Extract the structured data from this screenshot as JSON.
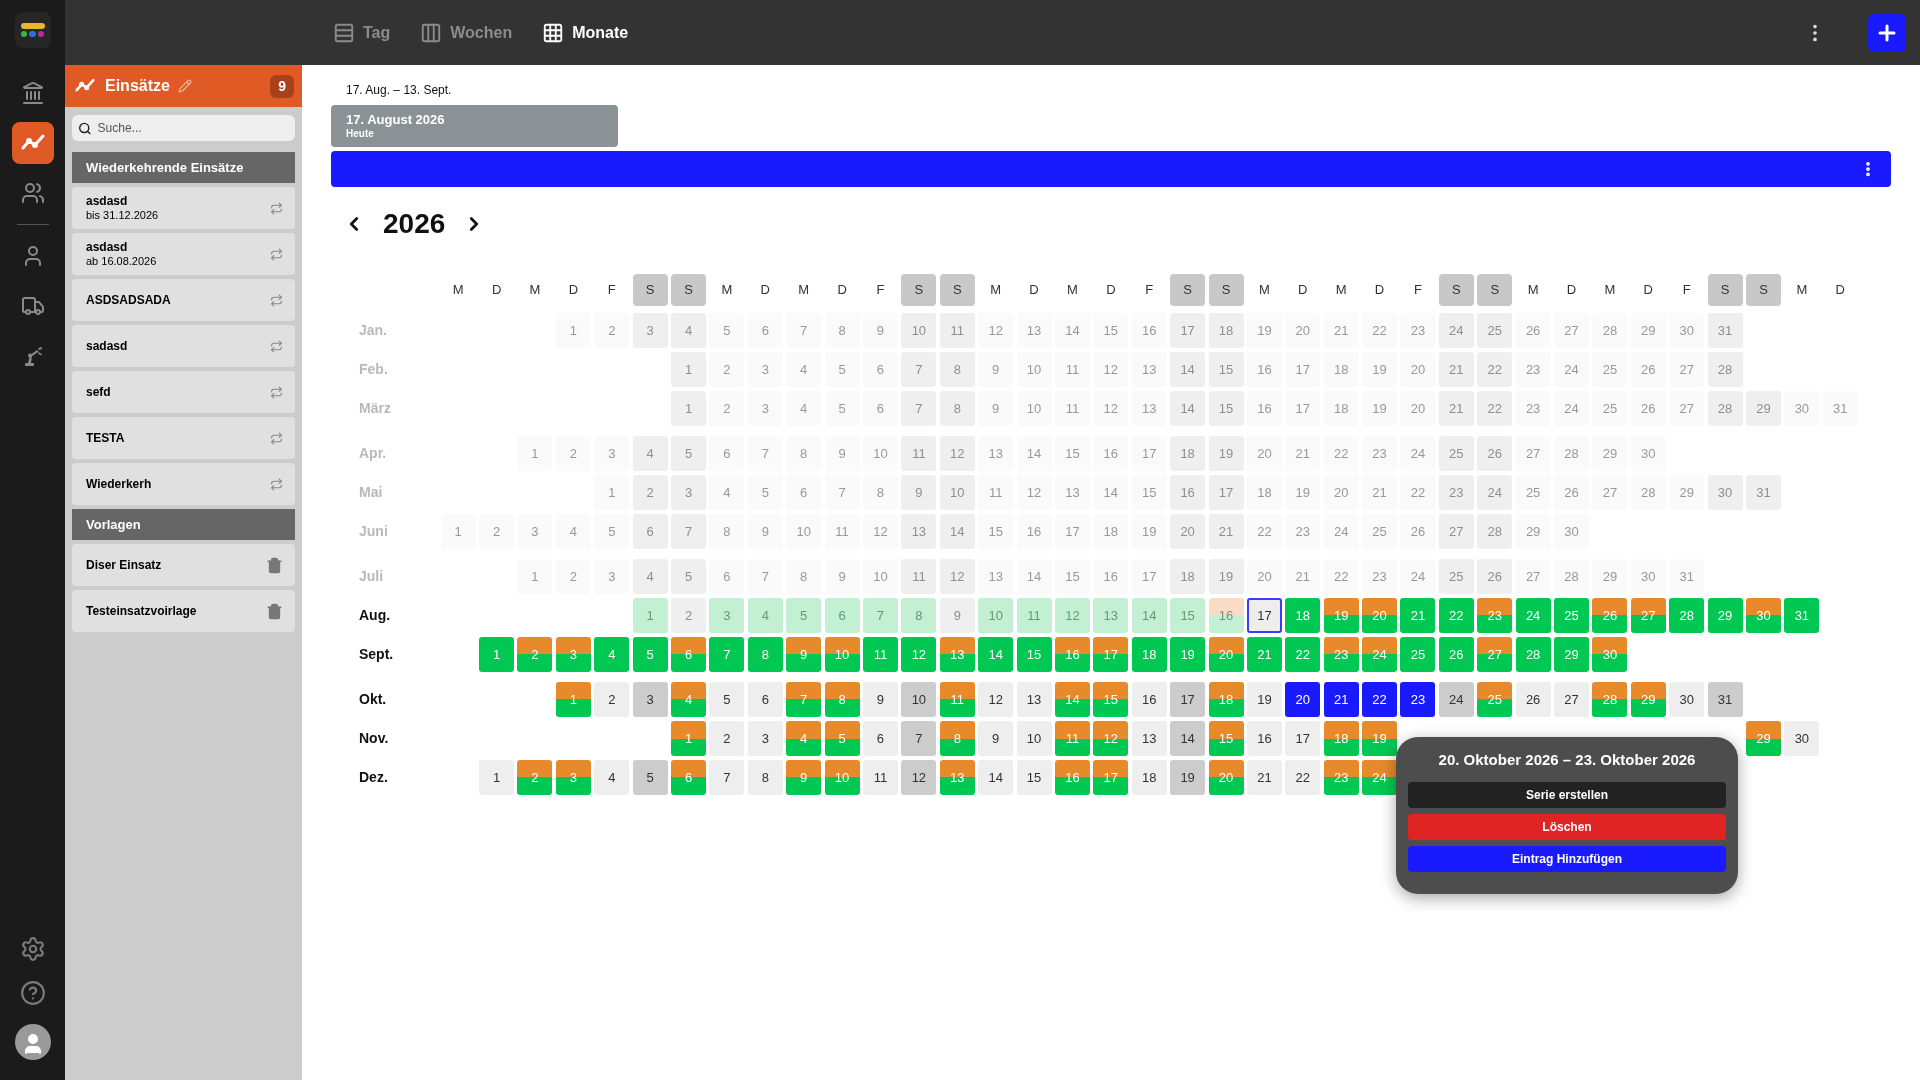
{
  "topbar": {
    "tabs": [
      {
        "label": "Tag",
        "kind": "day",
        "selected": false
      },
      {
        "label": "Wochen",
        "kind": "week",
        "selected": false
      },
      {
        "label": "Monate",
        "kind": "month",
        "selected": true
      }
    ]
  },
  "rail": {
    "groups": [
      [
        {
          "kind": "building",
          "selected": false
        },
        {
          "kind": "trend",
          "selected": true
        },
        {
          "kind": "team",
          "selected": false
        }
      ],
      [
        {
          "kind": "person",
          "selected": false
        },
        {
          "kind": "truck",
          "selected": false
        },
        {
          "kind": "robot",
          "selected": false
        }
      ]
    ]
  },
  "panel": {
    "title": "Einsätze",
    "count": "9",
    "search": {
      "placeholder": "Suche..."
    },
    "sections": [
      {
        "title": "Wiederkehrende Einsätze",
        "kind": "recurring",
        "items": [
          {
            "title": "asdasd",
            "subtitle": "bis 31.12.2026"
          },
          {
            "title": "asdasd",
            "subtitle": "ab 16.08.2026"
          },
          {
            "title": "ASDSADSADA"
          },
          {
            "title": "sadasd"
          },
          {
            "title": "sefd"
          },
          {
            "title": "TESTA"
          },
          {
            "title": "Wiederkerh"
          }
        ]
      },
      {
        "title": "Vorlagen",
        "kind": "template",
        "items": [
          {
            "title": "Diser Einsatz"
          },
          {
            "title": "Testeinsatzvoirlage"
          }
        ]
      }
    ]
  },
  "main": {
    "range": "17. Aug. – 13. Sept.",
    "today_card": {
      "title": "17. August 2026",
      "subtitle": "Heute"
    },
    "calendar": {
      "year": "2026",
      "weekdays": [
        "M",
        "D",
        "M",
        "D",
        "F",
        "S",
        "S",
        "M",
        "D",
        "M",
        "D",
        "F",
        "S",
        "S",
        "M",
        "D",
        "M",
        "D",
        "F",
        "S",
        "S",
        "M",
        "D",
        "M",
        "D",
        "F",
        "S",
        "S",
        "M",
        "D",
        "M",
        "D",
        "F",
        "S",
        "S",
        "M",
        "D"
      ],
      "months": [
        {
          "label": "Jan.",
          "past": true,
          "days": [
            {
              "label": "1",
              "kind": "past"
            },
            {
              "label": "2",
              "kind": "past"
            },
            {
              "label": "3",
              "kind": "past"
            },
            {
              "label": "4",
              "kind": "past"
            },
            {
              "label": "5",
              "kind": "past"
            },
            {
              "label": "6",
              "kind": "past"
            },
            {
              "label": "7",
              "kind": "past"
            },
            {
              "label": "8",
              "kind": "past"
            },
            {
              "label": "9",
              "kind": "past"
            },
            {
              "label": "10",
              "kind": "past"
            },
            {
              "label": "11",
              "kind": "past"
            },
            {
              "label": "12",
              "kind": "past"
            },
            {
              "label": "13",
              "kind": "past"
            },
            {
              "label": "14",
              "kind": "past"
            },
            {
              "label": "15",
              "kind": "past"
            },
            {
              "label": "16",
              "kind": "past"
            },
            {
              "label": "17",
              "kind": "past"
            },
            {
              "label": "18",
              "kind": "past"
            },
            {
              "label": "19",
              "kind": "past"
            },
            {
              "label": "20",
              "kind": "past"
            },
            {
              "label": "21",
              "kind": "past"
            },
            {
              "label": "22",
              "kind": "past"
            },
            {
              "label": "23",
              "kind": "past"
            },
            {
              "label": "24",
              "kind": "past"
            },
            {
              "label": "25",
              "kind": "past"
            },
            {
              "label": "26",
              "kind": "past"
            },
            {
              "label": "27",
              "kind": "past"
            },
            {
              "label": "28",
              "kind": "past"
            },
            {
              "label": "29",
              "kind": "past"
            },
            {
              "label": "30",
              "kind": "past"
            },
            {
              "label": "31",
              "kind": "past"
            }
          ]
        },
        {
          "label": "Feb.",
          "past": true,
          "days": [
            {
              "label": "1",
              "kind": "past"
            },
            {
              "label": "2",
              "kind": "past"
            },
            {
              "label": "3",
              "kind": "past"
            },
            {
              "label": "4",
              "kind": "past"
            },
            {
              "label": "5",
              "kind": "past"
            },
            {
              "label": "6",
              "kind": "past"
            },
            {
              "label": "7",
              "kind": "past"
            },
            {
              "label": "8",
              "kind": "past"
            },
            {
              "label": "9",
              "kind": "past"
            },
            {
              "label": "10",
              "kind": "past"
            },
            {
              "label": "11",
              "kind": "past"
            },
            {
              "label": "12",
              "kind": "past"
            },
            {
              "label": "13",
              "kind": "past"
            },
            {
              "label": "14",
              "kind": "past"
            },
            {
              "label": "15",
              "kind": "past"
            },
            {
              "label": "16",
              "kind": "past"
            },
            {
              "label": "17",
              "kind": "past"
            },
            {
              "label": "18",
              "kind": "past"
            },
            {
              "label": "19",
              "kind": "past"
            },
            {
              "label": "20",
              "kind": "past"
            },
            {
              "label": "21",
              "kind": "past"
            },
            {
              "label": "22",
              "kind": "past"
            },
            {
              "label": "23",
              "kind": "past"
            },
            {
              "label": "24",
              "kind": "past"
            },
            {
              "label": "25",
              "kind": "past"
            },
            {
              "label": "26",
              "kind": "past"
            },
            {
              "label": "27",
              "kind": "past"
            },
            {
              "label": "28",
              "kind": "past"
            }
          ]
        },
        {
          "label": "März",
          "past": true,
          "days": [
            {
              "label": "1",
              "kind": "past"
            },
            {
              "label": "2",
              "kind": "past"
            },
            {
              "label": "3",
              "kind": "past"
            },
            {
              "label": "4",
              "kind": "past"
            },
            {
              "label": "5",
              "kind": "past"
            },
            {
              "label": "6",
              "kind": "past"
            },
            {
              "label": "7",
              "kind": "past"
            },
            {
              "label": "8",
              "kind": "past"
            },
            {
              "label": "9",
              "kind": "past"
            },
            {
              "label": "10",
              "kind": "past"
            },
            {
              "label": "11",
              "kind": "past"
            },
            {
              "label": "12",
              "kind": "past"
            },
            {
              "label": "13",
              "kind": "past"
            },
            {
              "label": "14",
              "kind": "past"
            },
            {
              "label": "15",
              "kind": "past"
            },
            {
              "label": "16",
              "kind": "past"
            },
            {
              "label": "17",
              "kind": "past"
            },
            {
              "label": "18",
              "kind": "past"
            },
            {
              "label": "19",
              "kind": "past"
            },
            {
              "label": "20",
              "kind": "past"
            },
            {
              "label": "21",
              "kind": "past"
            },
            {
              "label": "22",
              "kind": "past"
            },
            {
              "label": "23",
              "kind": "past"
            },
            {
              "label": "24",
              "kind": "past"
            },
            {
              "label": "25",
              "kind": "past"
            },
            {
              "label": "26",
              "kind": "past"
            },
            {
              "label": "27",
              "kind": "past"
            },
            {
              "label": "28",
              "kind": "past"
            },
            {
              "label": "29",
              "kind": "past"
            },
            {
              "label": "30",
              "kind": "past"
            },
            {
              "label": "31",
              "kind": "past"
            }
          ]
        },
        {
          "label": "Apr.",
          "past": true,
          "days": [
            {
              "label": "1",
              "kind": "past"
            },
            {
              "label": "2",
              "kind": "past"
            },
            {
              "label": "3",
              "kind": "past"
            },
            {
              "label": "4",
              "kind": "past"
            },
            {
              "label": "5",
              "kind": "past"
            },
            {
              "label": "6",
              "kind": "past"
            },
            {
              "label": "7",
              "kind": "past"
            },
            {
              "label": "8",
              "kind": "past"
            },
            {
              "label": "9",
              "kind": "past"
            },
            {
              "label": "10",
              "kind": "past"
            },
            {
              "label": "11",
              "kind": "past"
            },
            {
              "label": "12",
              "kind": "past"
            },
            {
              "label": "13",
              "kind": "past"
            },
            {
              "label": "14",
              "kind": "past"
            },
            {
              "label": "15",
              "kind": "past"
            },
            {
              "label": "16",
              "kind": "past"
            },
            {
              "label": "17",
              "kind": "past"
            },
            {
              "label": "18",
              "kind": "past"
            },
            {
              "label": "19",
              "kind": "past"
            },
            {
              "label": "20",
              "kind": "past"
            },
            {
              "label": "21",
              "kind": "past"
            },
            {
              "label": "22",
              "kind": "past"
            },
            {
              "label": "23",
              "kind": "past"
            },
            {
              "label": "24",
              "kind": "past"
            },
            {
              "label": "25",
              "kind": "past"
            },
            {
              "label": "26",
              "kind": "past"
            },
            {
              "label": "27",
              "kind": "past"
            },
            {
              "label": "28",
              "kind": "past"
            },
            {
              "label": "29",
              "kind": "past"
            },
            {
              "label": "30",
              "kind": "past"
            }
          ]
        },
        {
          "label": "Mai",
          "past": true,
          "days": [
            {
              "label": "1",
              "kind": "past"
            },
            {
              "label": "2",
              "kind": "past"
            },
            {
              "label": "3",
              "kind": "past"
            },
            {
              "label": "4",
              "kind": "past"
            },
            {
              "label": "5",
              "kind": "past"
            },
            {
              "label": "6",
              "kind": "past"
            },
            {
              "label": "7",
              "kind": "past"
            },
            {
              "label": "8",
              "kind": "past"
            },
            {
              "label": "9",
              "kind": "past"
            },
            {
              "label": "10",
              "kind": "past"
            },
            {
              "label": "11",
              "kind": "past"
            },
            {
              "label": "12",
              "kind": "past"
            },
            {
              "label": "13",
              "kind": "past"
            },
            {
              "label": "14",
              "kind": "past"
            },
            {
              "label": "15",
              "kind": "past"
            },
            {
              "label": "16",
              "kind": "past"
            },
            {
              "label": "17",
              "kind": "past"
            },
            {
              "label": "18",
              "kind": "past"
            },
            {
              "label": "19",
              "kind": "past"
            },
            {
              "label": "20",
              "kind": "past"
            },
            {
              "label": "21",
              "kind": "past"
            },
            {
              "label": "22",
              "kind": "past"
            },
            {
              "label": "23",
              "kind": "past"
            },
            {
              "label": "24",
              "kind": "past"
            },
            {
              "label": "25",
              "kind": "past"
            },
            {
              "label": "26",
              "kind": "past"
            },
            {
              "label": "27",
              "kind": "past"
            },
            {
              "label": "28",
              "kind": "past"
            },
            {
              "label": "29",
              "kind": "past"
            },
            {
              "label": "30",
              "kind": "past"
            },
            {
              "label": "31",
              "kind": "past"
            }
          ]
        },
        {
          "label": "Juni",
          "past": true,
          "days": [
            {
              "label": "1",
              "kind": "past"
            },
            {
              "label": "2",
              "kind": "past"
            },
            {
              "label": "3",
              "kind": "past"
            },
            {
              "label": "4",
              "kind": "past"
            },
            {
              "label": "5",
              "kind": "past"
            },
            {
              "label": "6",
              "kind": "past"
            },
            {
              "label": "7",
              "kind": "past"
            },
            {
              "label": "8",
              "kind": "past"
            },
            {
              "label": "9",
              "kind": "past"
            },
            {
              "label": "10",
              "kind": "past"
            },
            {
              "label": "11",
              "kind": "past"
            },
            {
              "label": "12",
              "kind": "past"
            },
            {
              "label": "13",
              "kind": "past"
            },
            {
              "label": "14",
              "kind": "past"
            },
            {
              "label": "15",
              "kind": "past"
            },
            {
              "label": "16",
              "kind": "past"
            },
            {
              "label": "17",
              "kind": "past"
            },
            {
              "label": "18",
              "kind": "past"
            },
            {
              "label": "19",
              "kind": "past"
            },
            {
              "label": "20",
              "kind": "past"
            },
            {
              "label": "21",
              "kind": "past"
            },
            {
              "label": "22",
              "kind": "past"
            },
            {
              "label": "23",
              "kind": "past"
            },
            {
              "label": "24",
              "kind": "past"
            },
            {
              "label": "25",
              "kind": "past"
            },
            {
              "label": "26",
              "kind": "past"
            },
            {
              "label": "27",
              "kind": "past"
            },
            {
              "label": "28",
              "kind": "past"
            },
            {
              "label": "29",
              "kind": "past"
            },
            {
              "label": "30",
              "kind": "past"
            }
          ]
        },
        {
          "label": "Juli",
          "past": true,
          "days": [
            {
              "label": "1",
              "kind": "past"
            },
            {
              "label": "2",
              "kind": "past"
            },
            {
              "label": "3",
              "kind": "past"
            },
            {
              "label": "4",
              "kind": "past"
            },
            {
              "label": "5",
              "kind": "past"
            },
            {
              "label": "6",
              "kind": "past"
            },
            {
              "label": "7",
              "kind": "past"
            },
            {
              "label": "8",
              "kind": "past"
            },
            {
              "label": "9",
              "kind": "past"
            },
            {
              "label": "10",
              "kind": "past"
            },
            {
              "label": "11",
              "kind": "past"
            },
            {
              "label": "12",
              "kind": "past"
            },
            {
              "label": "13",
              "kind": "past"
            },
            {
              "label": "14",
              "kind": "past"
            },
            {
              "label": "15",
              "kind": "past"
            },
            {
              "label": "16",
              "kind": "past"
            },
            {
              "label": "17",
              "kind": "past"
            },
            {
              "label": "18",
              "kind": "past"
            },
            {
              "label": "19",
              "kind": "past"
            },
            {
              "label": "20",
              "kind": "past"
            },
            {
              "label": "21",
              "kind": "past"
            },
            {
              "label": "22",
              "kind": "past"
            },
            {
              "label": "23",
              "kind": "past"
            },
            {
              "label": "24",
              "kind": "past"
            },
            {
              "label": "25",
              "kind": "past"
            },
            {
              "label": "26",
              "kind": "past"
            },
            {
              "label": "27",
              "kind": "past"
            },
            {
              "label": "28",
              "kind": "past"
            },
            {
              "label": "29",
              "kind": "past"
            },
            {
              "label": "30",
              "kind": "past"
            },
            {
              "label": "31",
              "kind": "past"
            }
          ]
        },
        {
          "label": "Aug.",
          "past": false,
          "days": [
            {
              "label": "1",
              "kind": "past-full"
            },
            {
              "label": "2",
              "kind": "past"
            },
            {
              "label": "3",
              "kind": "past-full"
            },
            {
              "label": "4",
              "kind": "past-full"
            },
            {
              "label": "5",
              "kind": "past-full"
            },
            {
              "label": "6",
              "kind": "past-full"
            },
            {
              "label": "7",
              "kind": "past-full"
            },
            {
              "label": "8",
              "kind": "past-full"
            },
            {
              "label": "9",
              "kind": "past"
            },
            {
              "label": "10",
              "kind": "past-full"
            },
            {
              "label": "11",
              "kind": "past-full"
            },
            {
              "label": "12",
              "kind": "past-full"
            },
            {
              "label": "13",
              "kind": "past-full"
            },
            {
              "label": "14",
              "kind": "past-full"
            },
            {
              "label": "15",
              "kind": "past-full"
            },
            {
              "label": "16",
              "kind": "past-partial"
            },
            {
              "label": "17",
              "kind": "today"
            },
            {
              "label": "18",
              "kind": "full"
            },
            {
              "label": "19",
              "kind": "partial"
            },
            {
              "label": "20",
              "kind": "partial"
            },
            {
              "label": "21",
              "kind": "full"
            },
            {
              "label": "22",
              "kind": "full"
            },
            {
              "label": "23",
              "kind": "partial"
            },
            {
              "label": "24",
              "kind": "full"
            },
            {
              "label": "25",
              "kind": "full"
            },
            {
              "label": "26",
              "kind": "partial"
            },
            {
              "label": "27",
              "kind": "partial"
            },
            {
              "label": "28",
              "kind": "full"
            },
            {
              "label": "29",
              "kind": "full"
            },
            {
              "label": "30",
              "kind": "partial"
            },
            {
              "label": "31",
              "kind": "full"
            }
          ]
        },
        {
          "label": "Sept.",
          "past": false,
          "days": [
            {
              "label": "1",
              "kind": "full"
            },
            {
              "label": "2",
              "kind": "partial"
            },
            {
              "label": "3",
              "kind": "partial"
            },
            {
              "label": "4",
              "kind": "full"
            },
            {
              "label": "5",
              "kind": "full"
            },
            {
              "label": "6",
              "kind": "partial"
            },
            {
              "label": "7",
              "kind": "full"
            },
            {
              "label": "8",
              "kind": "full"
            },
            {
              "label": "9",
              "kind": "partial"
            },
            {
              "label": "10",
              "kind": "partial"
            },
            {
              "label": "11",
              "kind": "full"
            },
            {
              "label": "12",
              "kind": "full"
            },
            {
              "label": "13",
              "kind": "partial"
            },
            {
              "label": "14",
              "kind": "full"
            },
            {
              "label": "15",
              "kind": "full"
            },
            {
              "label": "16",
              "kind": "partial"
            },
            {
              "label": "17",
              "kind": "partial"
            },
            {
              "label": "18",
              "kind": "full"
            },
            {
              "label": "19",
              "kind": "full"
            },
            {
              "label": "20",
              "kind": "partial"
            },
            {
              "label": "21",
              "kind": "full"
            },
            {
              "label": "22",
              "kind": "full"
            },
            {
              "label": "23",
              "kind": "partial"
            },
            {
              "label": "24",
              "kind": "partial"
            },
            {
              "label": "25",
              "kind": "full"
            },
            {
              "label": "26",
              "kind": "full"
            },
            {
              "label": "27",
              "kind": "partial"
            },
            {
              "label": "28",
              "kind": "full"
            },
            {
              "label": "29",
              "kind": "full"
            },
            {
              "label": "30",
              "kind": "partial"
            }
          ]
        },
        {
          "label": "Okt.",
          "past": false,
          "days": [
            {
              "label": "1",
              "kind": "partial"
            },
            {
              "label": "2",
              "kind": "free"
            },
            {
              "label": "3",
              "kind": "free"
            },
            {
              "label": "4",
              "kind": "partial"
            },
            {
              "label": "5",
              "kind": "free"
            },
            {
              "label": "6",
              "kind": "free"
            },
            {
              "label": "7",
              "kind": "partial"
            },
            {
              "label": "8",
              "kind": "partial"
            },
            {
              "label": "9",
              "kind": "free"
            },
            {
              "label": "10",
              "kind": "free"
            },
            {
              "label": "11",
              "kind": "partial"
            },
            {
              "label": "12",
              "kind": "free"
            },
            {
              "label": "13",
              "kind": "free"
            },
            {
              "label": "14",
              "kind": "partial"
            },
            {
              "label": "15",
              "kind": "partial"
            },
            {
              "label": "16",
              "kind": "free"
            },
            {
              "label": "17",
              "kind": "free"
            },
            {
              "label": "18",
              "kind": "partial"
            },
            {
              "label": "19",
              "kind": "free"
            },
            {
              "label": "20",
              "kind": "selected"
            },
            {
              "label": "21",
              "kind": "selected"
            },
            {
              "label": "22",
              "kind": "selected"
            },
            {
              "label": "23",
              "kind": "selected"
            },
            {
              "label": "24",
              "kind": "free"
            },
            {
              "label": "25",
              "kind": "partial"
            },
            {
              "label": "26",
              "kind": "free"
            },
            {
              "label": "27",
              "kind": "free"
            },
            {
              "label": "28",
              "kind": "partial"
            },
            {
              "label": "29",
              "kind": "partial"
            },
            {
              "label": "30",
              "kind": "free"
            },
            {
              "label": "31",
              "kind": "free"
            }
          ]
        },
        {
          "label": "Nov.",
          "past": false,
          "days": [
            {
              "label": "1",
              "kind": "partial"
            },
            {
              "label": "2",
              "kind": "free"
            },
            {
              "label": "3",
              "kind": "free"
            },
            {
              "label": "4",
              "kind": "partial"
            },
            {
              "label": "5",
              "kind": "partial"
            },
            {
              "label": "6",
              "kind": "free"
            },
            {
              "label": "7",
              "kind": "free"
            },
            {
              "label": "8",
              "kind": "partial"
            },
            {
              "label": "9",
              "kind": "free"
            },
            {
              "label": "10",
              "kind": "free"
            },
            {
              "label": "11",
              "kind": "partial"
            },
            {
              "label": "12",
              "kind": "partial"
            },
            {
              "label": "13",
              "kind": "free"
            },
            {
              "label": "14",
              "kind": "free"
            },
            {
              "label": "15",
              "kind": "partial"
            },
            {
              "label": "16",
              "kind": "free"
            },
            {
              "label": "17",
              "kind": "free"
            },
            {
              "label": "18",
              "kind": "partial"
            },
            {
              "label": "19",
              "kind": "partial"
            },
            {
              "kind": "covered"
            },
            {
              "kind": "covered"
            },
            {
              "kind": "covered"
            },
            {
              "kind": "covered"
            },
            {
              "kind": "covered"
            },
            {
              "kind": "covered"
            },
            {
              "kind": "covered"
            },
            {
              "kind": "covered"
            },
            {
              "kind": "covered"
            },
            {
              "label": "29",
              "kind": "partial"
            },
            {
              "label": "30",
              "kind": "free"
            }
          ]
        },
        {
          "label": "Dez.",
          "past": false,
          "days": [
            {
              "label": "1",
              "kind": "free"
            },
            {
              "label": "2",
              "kind": "partial"
            },
            {
              "label": "3",
              "kind": "partial"
            },
            {
              "label": "4",
              "kind": "free"
            },
            {
              "label": "5",
              "kind": "free"
            },
            {
              "label": "6",
              "kind": "partial"
            },
            {
              "label": "7",
              "kind": "free"
            },
            {
              "label": "8",
              "kind": "free"
            },
            {
              "label": "9",
              "kind": "partial"
            },
            {
              "label": "10",
              "kind": "partial"
            },
            {
              "label": "11",
              "kind": "free"
            },
            {
              "label": "12",
              "kind": "free"
            },
            {
              "label": "13",
              "kind": "partial"
            },
            {
              "label": "14",
              "kind": "free"
            },
            {
              "label": "15",
              "kind": "free"
            },
            {
              "label": "16",
              "kind": "partial"
            },
            {
              "label": "17",
              "kind": "partial"
            },
            {
              "label": "18",
              "kind": "free"
            },
            {
              "label": "19",
              "kind": "free"
            },
            {
              "label": "20",
              "kind": "partial"
            },
            {
              "label": "21",
              "kind": "free"
            },
            {
              "label": "22",
              "kind": "free"
            },
            {
              "label": "23",
              "kind": "partial"
            },
            {
              "label": "24",
              "kind": "partial"
            }
          ]
        }
      ]
    },
    "popup": {
      "title": "20. Oktober 2026 – 23. Oktober 2026",
      "buttons": [
        {
          "label": "Serie erstellen",
          "kind": "dark"
        },
        {
          "label": "Löschen",
          "kind": "danger"
        },
        {
          "label": "Eintrag Hinzufügen",
          "kind": "primary"
        }
      ]
    }
  }
}
